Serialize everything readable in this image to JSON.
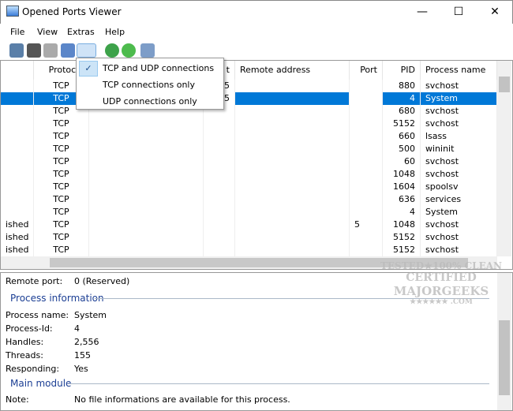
{
  "window": {
    "title": "Opened Ports Viewer",
    "minimize": "—",
    "maximize": "☐",
    "close": "✕"
  },
  "menu": [
    "File",
    "View",
    "Extras",
    "Help"
  ],
  "toolbar": {
    "icons": [
      "add-icon",
      "connect-icon",
      "settings-icon",
      "satellite-icon",
      "filter-dropdown-icon",
      "refresh-icon",
      "auto-refresh-icon",
      "tools-icon"
    ]
  },
  "filter_menu": {
    "items": [
      "TCP and UDP connections",
      "TCP connections only",
      "UDP connections only"
    ],
    "checked": 0
  },
  "columns": [
    "",
    "Protocol",
    "",
    "t",
    "Remote address",
    "Port",
    "PID",
    "Process name"
  ],
  "rows": [
    {
      "state": "",
      "protocol": "TCP",
      "lport": "5",
      "rport": "",
      "pid": "880",
      "process": "svchost"
    },
    {
      "state": "",
      "protocol": "TCP",
      "lport": "5",
      "rport": "",
      "pid": "4",
      "process": "System",
      "selected": true
    },
    {
      "state": "",
      "protocol": "TCP",
      "lport": "",
      "rport": "",
      "pid": "680",
      "process": "svchost"
    },
    {
      "state": "",
      "protocol": "TCP",
      "lport": "",
      "rport": "",
      "pid": "5152",
      "process": "svchost"
    },
    {
      "state": "",
      "protocol": "TCP",
      "lport": "",
      "rport": "",
      "pid": "660",
      "process": "lsass"
    },
    {
      "state": "",
      "protocol": "TCP",
      "lport": "",
      "rport": "",
      "pid": "500",
      "process": "wininit"
    },
    {
      "state": "",
      "protocol": "TCP",
      "lport": "",
      "rport": "",
      "pid": "60",
      "process": "svchost"
    },
    {
      "state": "",
      "protocol": "TCP",
      "lport": "",
      "rport": "",
      "pid": "1048",
      "process": "svchost"
    },
    {
      "state": "",
      "protocol": "TCP",
      "lport": "",
      "rport": "",
      "pid": "1604",
      "process": "spoolsv"
    },
    {
      "state": "",
      "protocol": "TCP",
      "lport": "",
      "rport": "",
      "pid": "636",
      "process": "services"
    },
    {
      "state": "",
      "protocol": "TCP",
      "lport": "",
      "rport": "",
      "pid": "4",
      "process": "System"
    },
    {
      "state": "ished",
      "protocol": "TCP",
      "lport": "",
      "rport": "5",
      "pid": "1048",
      "process": "svchost"
    },
    {
      "state": "ished",
      "protocol": "TCP",
      "lport": "",
      "rport": "",
      "pid": "5152",
      "process": "svchost"
    },
    {
      "state": "ished",
      "protocol": "TCP",
      "lport": "",
      "rport": "",
      "pid": "5152",
      "process": "svchost"
    }
  ],
  "details": {
    "remote_port": {
      "label": "Remote port:",
      "value": "0 (Reserved)"
    },
    "process_group": "Process information",
    "fields": [
      {
        "label": "Process name:",
        "value": "System"
      },
      {
        "label": "Process-Id:",
        "value": "4"
      },
      {
        "label": "Handles:",
        "value": "2,556"
      },
      {
        "label": "Threads:",
        "value": "155"
      },
      {
        "label": "Responding:",
        "value": "Yes"
      }
    ],
    "module_group": "Main module",
    "note": {
      "label": "Note:",
      "value": "No file informations are available for this process."
    }
  },
  "watermark": [
    "TESTED★100% CLEAN",
    "CERTIFIED",
    "MAJORGEEKS",
    "★★★★★★ .COM"
  ]
}
